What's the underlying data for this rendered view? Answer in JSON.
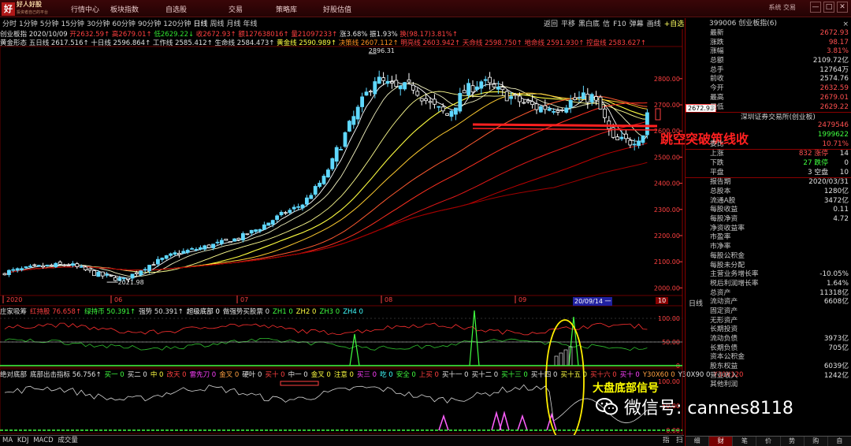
{
  "app": {
    "logo_mark": "好",
    "logo_text": "好人好股",
    "logo_sub": "投资者自己的平台",
    "menus": [
      "行情中心",
      "板块指数",
      "自选股",
      "交易",
      "策略库",
      "好股估值"
    ],
    "system_menu": "系统  交易",
    "window_buttons": [
      "—",
      "□",
      "✕"
    ]
  },
  "toolbar": {
    "periods": [
      "分时",
      "1分钟",
      "5分钟",
      "15分钟",
      "30分钟",
      "60分钟",
      "90分钟",
      "120分钟",
      "日线",
      "周线",
      "月线",
      "年线"
    ],
    "active_period": "日线",
    "tools": [
      "返回",
      "平移",
      "黑白底",
      "信",
      "F10",
      "弹幕",
      "画线",
      "+自选"
    ]
  },
  "header": {
    "line1": {
      "name": "创业板指",
      "date": "2020/10/09",
      "open": "开2632.59↑",
      "high": "高2679.01↑",
      "low": "低2629.22↓",
      "close": "收2672.93↑",
      "amount": "额127638016↑",
      "volume": "量21097233↑",
      "change": "涨3.68%",
      "amplitude": "振1.93%",
      "turnover": "换(98.17)3.81%↑"
    },
    "line2": {
      "label": "黄金形态",
      "ma5": "五日线 2617.516↑",
      "ma10": "十日线 2596.864↑",
      "ma_work": "工作线 2585.412↑",
      "ma_life": "生命线 2584.473↑",
      "ma_gold": "黄金线 2590.989↑",
      "ma_decision": "决策线 2607.112↑",
      "ma_bright": "明亮线 2603.942↑",
      "ma_sky": "天命线 2598.750↑",
      "ma_earth": "地命线 2591.930↑",
      "ma_control": "控盘线 2583.627↑"
    }
  },
  "chart_data": {
    "type": "candlestick",
    "y_ticks": [
      "2800.00",
      "2700.00",
      "2600.00",
      "2500.00",
      "2400.00",
      "2300.00",
      "2200.00",
      "2100.00",
      "2000.00"
    ],
    "x_ticks": [
      "2020",
      "06",
      "07",
      "08",
      "09"
    ],
    "high_marker": "2896.31",
    "low_marker": "2021.98",
    "current_price_tag": "2672.93",
    "cursor_date": "20/09/14 一",
    "page_tag": "10",
    "series_colors": {
      "up": "#5fd8ff",
      "down": "#ffffff",
      "ma_fast": "#ffffff",
      "ma_mid": "#ffff40",
      "ma_slow": "#ff2020"
    }
  },
  "indicator1": {
    "name": "庄家吸筹",
    "fields": [
      "红持股 76.658↑",
      "绿持币 50.391↑",
      "强势 50.391↑",
      "超级底部 0",
      "做强势买股票 0",
      "ZH1 0",
      "ZH2 0",
      "ZH3 0",
      "ZH4 0"
    ],
    "y_ticks": [
      "100.00",
      "50.00",
      "0"
    ]
  },
  "indicator2": {
    "name": "绝对底部",
    "fields": [
      "底部出击指标 56.756↑",
      "买一 0",
      "买二 0",
      "中 0",
      "改天 0",
      "雷先刀 0",
      "金叉 0",
      "硬叶 0",
      "买十 0",
      "中一 0",
      "金叉 0",
      "注意 0",
      "买三 0",
      "吃 0",
      "安全 0",
      "上买 0",
      "买十一 0",
      "买十二 0",
      "买十三 0",
      "买十四 0",
      "买十五 0",
      "买十六 0",
      "买十 0",
      "Y30X60 0",
      "Y30X90 0",
      "Y30X120"
    ],
    "y_ticks": [
      "100.00",
      "50.00",
      "0.00"
    ]
  },
  "annotations": {
    "gap_breakout": "跳空突破筑线收",
    "big_bottom": "大盘底部信号",
    "wechat": "微信号: cannes8118"
  },
  "right_panel": {
    "title": "399006 创业板指(6)",
    "quote": [
      {
        "k": "最新",
        "v": "2672.93",
        "c": "vr"
      },
      {
        "k": "涨跌",
        "v": "98.17",
        "c": "vr"
      },
      {
        "k": "涨幅",
        "v": "3.81%",
        "c": "vr"
      },
      {
        "k": "总额",
        "v": "2109.72亿",
        "c": "vw"
      },
      {
        "k": "总手",
        "v": "12764万",
        "c": "vw"
      },
      {
        "k": "前收",
        "v": "2574.76",
        "c": "vw"
      },
      {
        "k": "今开",
        "v": "2632.59",
        "c": "vr"
      },
      {
        "k": "最高",
        "v": "2679.01",
        "c": "vr"
      },
      {
        "k": "最低",
        "v": "2629.22",
        "c": "vr"
      }
    ],
    "exchange": "深圳证券交易所(创业板)",
    "orders": [
      {
        "k": "",
        "v": "2479546",
        "c": "vr"
      },
      {
        "k": "",
        "v": "1999622",
        "c": "vg"
      },
      {
        "k": "委比",
        "v": "10.71%",
        "c": "vr"
      }
    ],
    "breadth": [
      {
        "k": "上涨",
        "v": "832 涨停",
        "v2": "14",
        "c": "vr"
      },
      {
        "k": "下跌",
        "v": "27 跌停",
        "v2": "0",
        "c": "vg"
      },
      {
        "k": "平盘",
        "v": "3 空盘",
        "v2": "10",
        "c": "vw"
      }
    ],
    "fundamentals": [
      {
        "k": "报告期",
        "v": "2020/03/31",
        "c": "vw"
      },
      {
        "k": "总股本",
        "v": "1280亿",
        "c": "vw"
      },
      {
        "k": "流通A股",
        "v": "3472亿",
        "c": "vw"
      },
      {
        "k": "每股收益",
        "v": "0.11",
        "c": "vw"
      },
      {
        "k": "每股净资",
        "v": "4.72",
        "c": "vw"
      },
      {
        "k": "净资收益率",
        "v": "",
        "c": "vw"
      },
      {
        "k": "市盈率",
        "v": "",
        "c": "vw"
      },
      {
        "k": "市净率",
        "v": "",
        "c": "vw"
      },
      {
        "k": "每股公积金",
        "v": "",
        "c": "vw"
      },
      {
        "k": "每股未分配",
        "v": "",
        "c": "vw"
      },
      {
        "k": "主营业务增长率",
        "v": "-10.05%",
        "c": "vw"
      },
      {
        "k": "税后利润增长率",
        "v": "1.64%",
        "c": "vw"
      },
      {
        "k": "总资产",
        "v": "11318亿",
        "c": "vw"
      },
      {
        "k": "流动资产",
        "v": "6608亿",
        "c": "vw"
      },
      {
        "k": "固定资产",
        "v": "",
        "c": "vw"
      },
      {
        "k": "无形资产",
        "v": "",
        "c": "vw"
      },
      {
        "k": "长期投资",
        "v": "",
        "c": "vw"
      },
      {
        "k": "流动负债",
        "v": "3973亿",
        "c": "vw"
      },
      {
        "k": "长期负债",
        "v": "705亿",
        "c": "vw"
      },
      {
        "k": "资本公积金",
        "v": "",
        "c": "vw"
      },
      {
        "k": "股东权益",
        "v": "6039亿",
        "c": "vw"
      },
      {
        "k": "营业收入",
        "v": "1242亿",
        "c": "vw"
      },
      {
        "k": "其他利润",
        "v": "",
        "c": "vw"
      }
    ],
    "tabs": [
      "细",
      "财",
      "笔",
      "价",
      "势",
      "购",
      "自"
    ],
    "active_tab": "财"
  },
  "bottom_tabs": [
    "MA",
    "KDJ",
    "MACD",
    "成交量"
  ],
  "bottom_right": [
    "指",
    "扫"
  ]
}
